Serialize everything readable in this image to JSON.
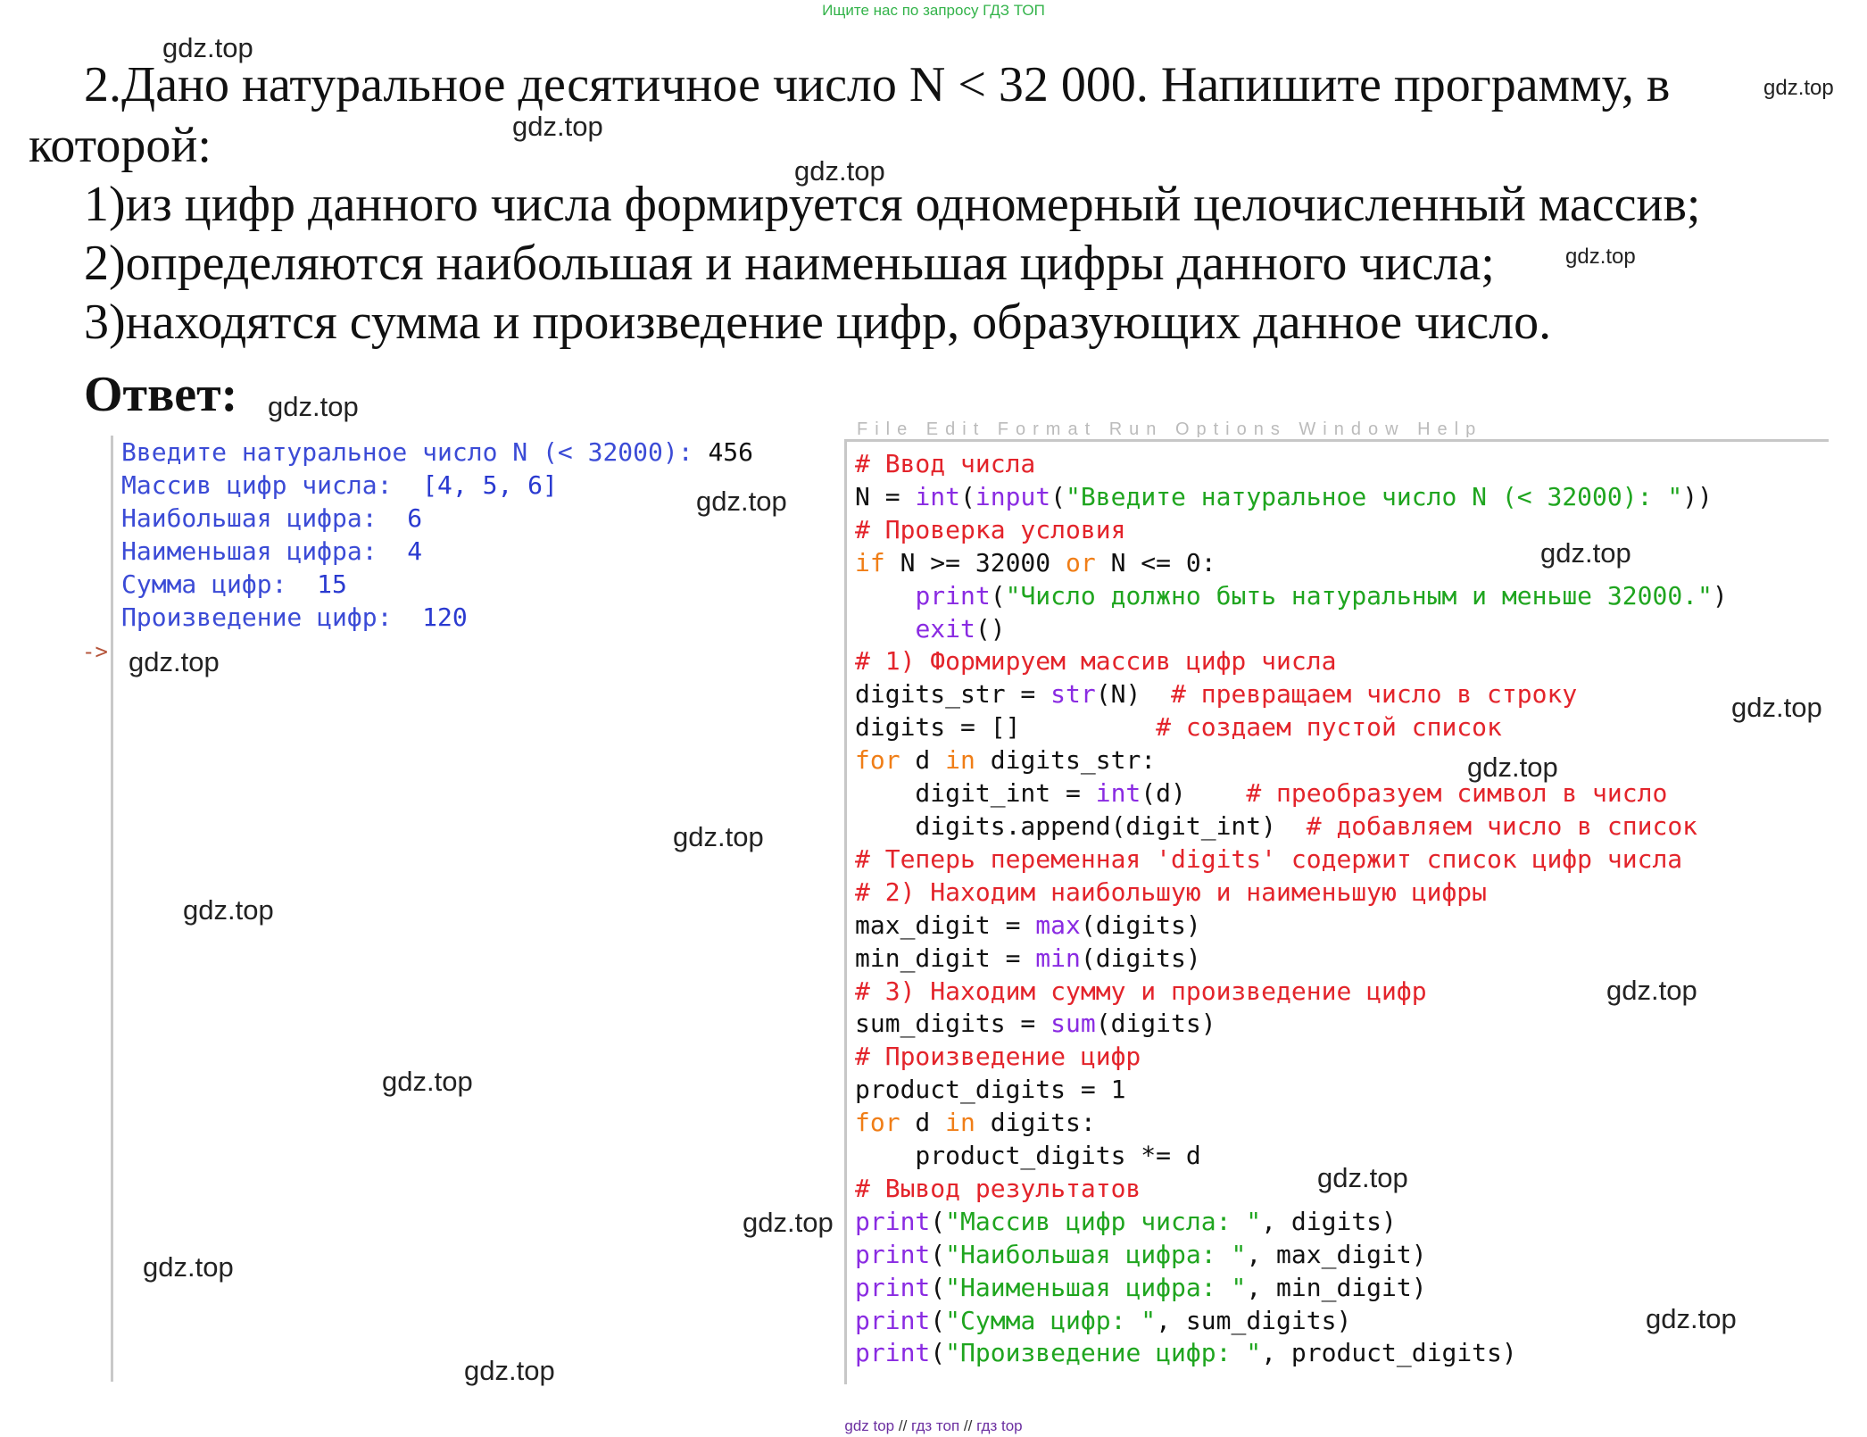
{
  "banner": "Ищите нас по запросу ГДЗ ТОП",
  "task": {
    "line1": "2.Дано натуральное десятичное число N < 32 000. Напишите программу, в",
    "line2": "которой:",
    "items": [
      "1)из цифр данного числа формируется одномерный целочисленный массив;",
      "2)определяются наибольшая и наименьшая цифры данного числа;",
      "3)находятся сумма и произведение цифр, образующих данное число."
    ],
    "answer_label": "Ответ:"
  },
  "shell": {
    "prompt": "->",
    "lines": [
      {
        "label": "Введите натуральное число N (< 32000): ",
        "value": "456"
      },
      {
        "label": "Массив цифр числа:  ",
        "value": "[4, 5, 6]"
      },
      {
        "label": "Наибольшая цифра:  ",
        "value": "6"
      },
      {
        "label": "Наименьшая цифра:  ",
        "value": "4"
      },
      {
        "label": "Сумма цифр:  ",
        "value": "15"
      },
      {
        "label": "Произведение цифр:  ",
        "value": "120"
      }
    ]
  },
  "editor": {
    "menu_hint": "File  Edit  Format  Run  Options  Window  Help",
    "code_lines": [
      [
        [
          "cm",
          "# Ввод числа"
        ]
      ],
      [
        [
          "tx",
          "N = "
        ],
        [
          "bi",
          "int"
        ],
        [
          "tx",
          "("
        ],
        [
          "bi",
          "input"
        ],
        [
          "tx",
          "("
        ],
        [
          "st",
          "\"Введите натуральное число N (< 32000): \""
        ],
        [
          "tx",
          "))"
        ]
      ],
      [
        [
          "cm",
          "# Проверка условия"
        ]
      ],
      [
        [
          "kw",
          "if"
        ],
        [
          "tx",
          " N >= 32000 "
        ],
        [
          "kw",
          "or"
        ],
        [
          "tx",
          " N <= 0:"
        ]
      ],
      [
        [
          "tx",
          "    "
        ],
        [
          "bi",
          "print"
        ],
        [
          "tx",
          "("
        ],
        [
          "st",
          "\"Число должно быть натуральным и меньше 32000.\""
        ],
        [
          "tx",
          ")"
        ]
      ],
      [
        [
          "tx",
          "    "
        ],
        [
          "bi",
          "exit"
        ],
        [
          "tx",
          "()"
        ]
      ],
      [
        [
          "cm",
          "# 1) Формируем массив цифр числа"
        ]
      ],
      [
        [
          "tx",
          "digits_str = "
        ],
        [
          "bi",
          "str"
        ],
        [
          "tx",
          "(N)  "
        ],
        [
          "cm",
          "# превращаем число в строку"
        ]
      ],
      [
        [
          "tx",
          "digits = []         "
        ],
        [
          "cm",
          "# создаем пустой список"
        ]
      ],
      [
        [
          "kw",
          "for"
        ],
        [
          "tx",
          " d "
        ],
        [
          "kw",
          "in"
        ],
        [
          "tx",
          " digits_str:"
        ]
      ],
      [
        [
          "tx",
          "    digit_int = "
        ],
        [
          "bi",
          "int"
        ],
        [
          "tx",
          "(d)    "
        ],
        [
          "cm",
          "# преобразуем символ в число"
        ]
      ],
      [
        [
          "tx",
          "    digits.append(digit_int)  "
        ],
        [
          "cm",
          "# добавляем число в список"
        ]
      ],
      [
        [
          "cm",
          "# Теперь переменная 'digits' содержит список цифр числа"
        ]
      ],
      [
        [
          "cm",
          "# 2) Находим наибольшую и наименьшую цифры"
        ]
      ],
      [
        [
          "tx",
          "max_digit = "
        ],
        [
          "bi",
          "max"
        ],
        [
          "tx",
          "(digits)"
        ]
      ],
      [
        [
          "tx",
          "min_digit = "
        ],
        [
          "bi",
          "min"
        ],
        [
          "tx",
          "(digits)"
        ]
      ],
      [
        [
          "cm",
          "# 3) Находим сумму и произведение цифр"
        ]
      ],
      [
        [
          "tx",
          "sum_digits = "
        ],
        [
          "bi",
          "sum"
        ],
        [
          "tx",
          "(digits)"
        ]
      ],
      [
        [
          "cm",
          "# Произведение цифр"
        ]
      ],
      [
        [
          "tx",
          "product_digits = 1"
        ]
      ],
      [
        [
          "kw",
          "for"
        ],
        [
          "tx",
          " d "
        ],
        [
          "kw",
          "in"
        ],
        [
          "tx",
          " digits:"
        ]
      ],
      [
        [
          "tx",
          "    product_digits *= d"
        ]
      ],
      [
        [
          "cm",
          "# Вывод результатов"
        ]
      ],
      [
        [
          "bi",
          "print"
        ],
        [
          "tx",
          "("
        ],
        [
          "st",
          "\"Массив цифр числа: \""
        ],
        [
          "tx",
          ", digits)"
        ]
      ],
      [
        [
          "bi",
          "print"
        ],
        [
          "tx",
          "("
        ],
        [
          "st",
          "\"Наибольшая цифра: \""
        ],
        [
          "tx",
          ", max_digit)"
        ]
      ],
      [
        [
          "bi",
          "print"
        ],
        [
          "tx",
          "("
        ],
        [
          "st",
          "\"Наименьшая цифра: \""
        ],
        [
          "tx",
          ", min_digit)"
        ]
      ],
      [
        [
          "bi",
          "print"
        ],
        [
          "tx",
          "("
        ],
        [
          "st",
          "\"Сумма цифр: \""
        ],
        [
          "tx",
          ", sum_digits)"
        ]
      ],
      [
        [
          "bi",
          "print"
        ],
        [
          "tx",
          "("
        ],
        [
          "st",
          "\"Произведение цифр: \""
        ],
        [
          "tx",
          ", product_digits)"
        ]
      ]
    ]
  },
  "watermark": "gdz.top",
  "footer": {
    "items": [
      "gdz top",
      "гдз топ",
      "гдз top"
    ],
    "separator": "//"
  },
  "colors": {
    "comment": "#e3242b",
    "keyword": "#f07e17",
    "builtin": "#8a2be2",
    "string": "#1fa51f",
    "shell_output": "#3b4bd6",
    "banner": "#33b34a",
    "footer": "#6b2fa0"
  }
}
